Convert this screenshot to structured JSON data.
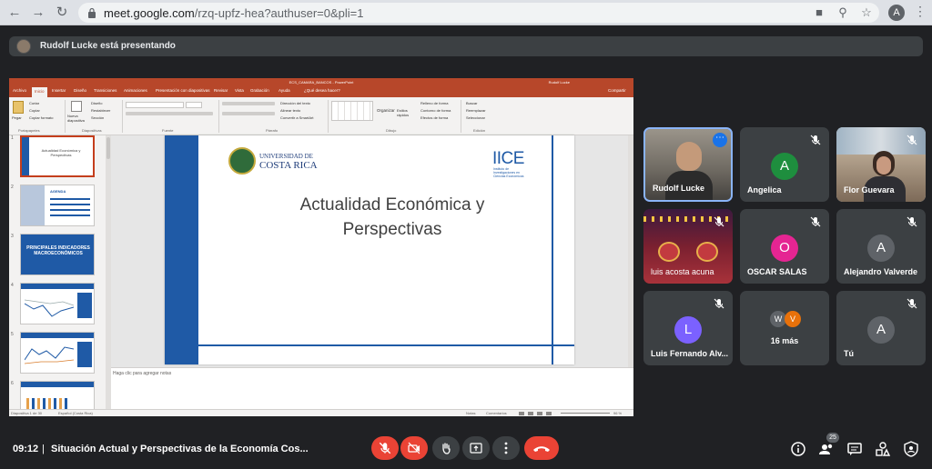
{
  "browser": {
    "url_host": "meet.google.com",
    "url_path": "/rzq-upfz-hea?authuser=0&pli=1",
    "profile_initial": "A"
  },
  "banner": {
    "presenter_text": "Rudolf Lucke está presentando"
  },
  "powerpoint": {
    "window_title": "ECS_CAMARA_BANCOS - PowerPoint",
    "user_name": "Rudolf Lucke",
    "tabs": [
      "Archivo",
      "Inicio",
      "Insertar",
      "Diseño",
      "Transiciones",
      "Animaciones",
      "Presentación con diapositivas",
      "Revisar",
      "Vista",
      "Grabación",
      "Ayuda",
      "¿Qué desea hacer?"
    ],
    "share_label": "Compartir",
    "ribbon_groups": [
      "Portapapeles",
      "Diapositivas",
      "Fuente",
      "Párrafo",
      "Dibujo",
      "Edición"
    ],
    "ribbon_buttons": {
      "paste": "Pegar",
      "cut": "Cortar",
      "copy": "Copiar",
      "format_painter": "Copiar formato",
      "new_slide": "Nueva diapositiva",
      "layout": "Diseño",
      "reset": "Restablecer",
      "section": "Sección",
      "text_direction": "Dirección del texto",
      "align_text": "Alinear texto",
      "smartart": "Convertir a SmartArt",
      "arrange": "Organizar",
      "quick_styles": "Estilos rápidos",
      "shape_fill": "Relleno de forma",
      "shape_outline": "Contorno de forma",
      "shape_effects": "Efectos de forma",
      "find": "Buscar",
      "replace": "Reemplazar",
      "select": "Seleccionar"
    },
    "thumbnails": [
      {
        "num": "1",
        "title": "Actualidad Económica y Perspectivas"
      },
      {
        "num": "2",
        "title": "AGENDA"
      },
      {
        "num": "3",
        "title": "PRINCIPALES INDICADORES MACROECONÓMICOS"
      },
      {
        "num": "4",
        "title": ""
      },
      {
        "num": "5",
        "title": ""
      },
      {
        "num": "6",
        "title": ""
      }
    ],
    "slide": {
      "title_line1": "Actualidad Económica y",
      "title_line2": "Perspectivas",
      "ucr_line1": "UNIVERSIDAD DE",
      "ucr_line2": "COSTA RICA",
      "iice_logo": "IICE",
      "iice_sub1": "Instituto de",
      "iice_sub2": "Investigaciones en",
      "iice_sub3": "Ciencias Económicas"
    },
    "notes_placeholder": "Haga clic para agregar notas",
    "status": {
      "slide_count": "Diapositiva 1 de 30",
      "language": "Español (Costa Rica)",
      "notes": "Notas",
      "comments": "Comentarios",
      "zoom": "96 %"
    }
  },
  "participants": [
    {
      "name": "Rudolf Lucke",
      "type": "video",
      "muted": false
    },
    {
      "name": "Angelica",
      "initial": "A",
      "color": "#1e8e3e",
      "muted": true
    },
    {
      "name": "Flor Guevara",
      "type": "video",
      "muted": true
    },
    {
      "name": "luis acosta acuna",
      "type": "video",
      "muted": true
    },
    {
      "name": "OSCAR SALAS",
      "initial": "O",
      "color": "#e52592",
      "muted": true
    },
    {
      "name": "Alejandro Valverde",
      "initial": "A",
      "color": "#5f6368",
      "muted": true
    },
    {
      "name": "Luis Fernando Alv...",
      "initial": "L",
      "color": "#7b61ff",
      "muted": true
    },
    {
      "name": "16 más",
      "initial_a": "W",
      "initial_b": "V",
      "muted": false
    },
    {
      "name": "Tú",
      "initial": "A",
      "color": "#5f6368",
      "muted": true
    }
  ],
  "bottom_bar": {
    "time": "09:12",
    "divider": "|",
    "meeting_title": "Situación Actual y Perspectivas de la Economía Cos...",
    "people_count": "25"
  }
}
